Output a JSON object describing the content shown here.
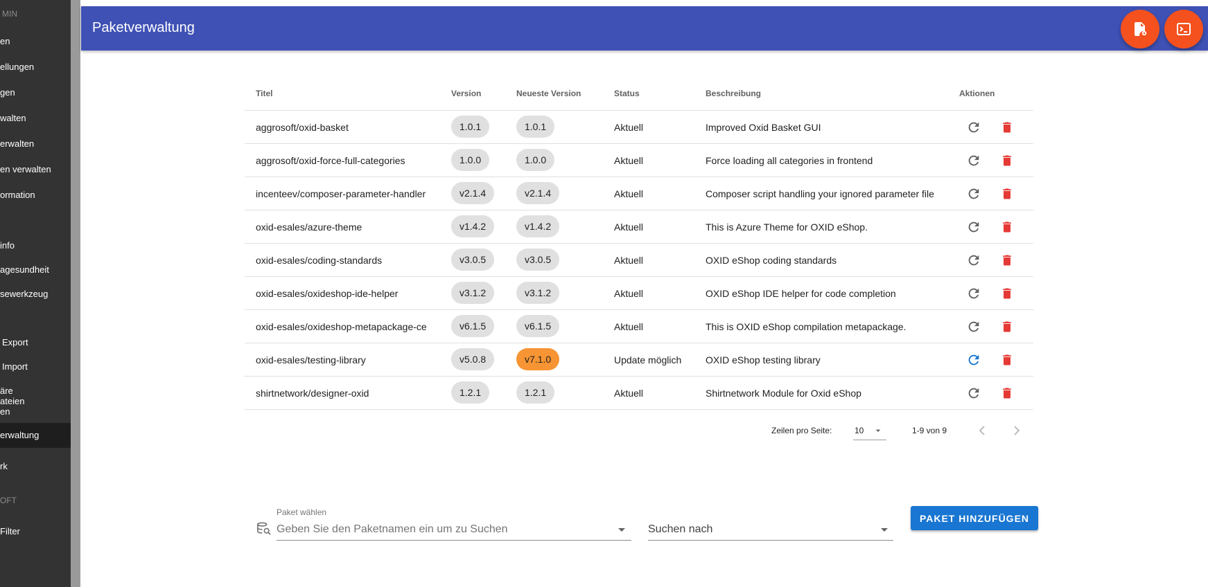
{
  "sidebar": {
    "items": [
      {
        "label": "MIN",
        "type": "section"
      },
      {
        "label": "en",
        "type": "item"
      },
      {
        "label": "ellungen",
        "type": "item"
      },
      {
        "label": "gen",
        "type": "item"
      },
      {
        "label": "walten",
        "type": "item"
      },
      {
        "label": "erwalten",
        "type": "item"
      },
      {
        "label": "en verwalten",
        "type": "item"
      },
      {
        "label": "ormation",
        "type": "item"
      },
      {
        "label": "info",
        "type": "item"
      },
      {
        "label": "agesundheit",
        "type": "item"
      },
      {
        "label": "sewerkzeug",
        "type": "item"
      },
      {
        "label": "Export",
        "type": "item"
      },
      {
        "label": "Import",
        "type": "item"
      },
      {
        "label": "äre\nateien\nen",
        "type": "item"
      },
      {
        "label": "erwaltung",
        "type": "item",
        "active": true
      },
      {
        "label": "rk",
        "type": "item"
      },
      {
        "label": "OFT",
        "type": "section"
      },
      {
        "label": "Filter",
        "type": "item"
      }
    ]
  },
  "appbar": {
    "title": "Paketverwaltung",
    "fab_icons": [
      "file-settings-icon",
      "console-icon"
    ]
  },
  "table": {
    "columns": [
      "Titel",
      "Version",
      "Neueste Version",
      "Status",
      "Beschreibung",
      "Aktionen"
    ],
    "rows": [
      {
        "title": "aggrosoft/oxid-basket",
        "version": "1.0.1",
        "latest": "1.0.1",
        "status": "Aktuell",
        "description": "Improved Oxid Basket GUI",
        "update": false
      },
      {
        "title": "aggrosoft/oxid-force-full-categories",
        "version": "1.0.0",
        "latest": "1.0.0",
        "status": "Aktuell",
        "description": "Force loading all categories in frontend",
        "update": false
      },
      {
        "title": "incenteev/composer-parameter-handler",
        "version": "v2.1.4",
        "latest": "v2.1.4",
        "status": "Aktuell",
        "description": "Composer script handling your ignored parameter file",
        "update": false
      },
      {
        "title": "oxid-esales/azure-theme",
        "version": "v1.4.2",
        "latest": "v1.4.2",
        "status": "Aktuell",
        "description": "This is Azure Theme for OXID eShop.",
        "update": false
      },
      {
        "title": "oxid-esales/coding-standards",
        "version": "v3.0.5",
        "latest": "v3.0.5",
        "status": "Aktuell",
        "description": "OXID eShop coding standards",
        "update": false
      },
      {
        "title": "oxid-esales/oxideshop-ide-helper",
        "version": "v3.1.2",
        "latest": "v3.1.2",
        "status": "Aktuell",
        "description": "OXID eShop IDE helper for code completion",
        "update": false
      },
      {
        "title": "oxid-esales/oxideshop-metapackage-ce",
        "version": "v6.1.5",
        "latest": "v6.1.5",
        "status": "Aktuell",
        "description": "This is OXID eShop compilation metapackage.",
        "update": false
      },
      {
        "title": "oxid-esales/testing-library",
        "version": "v5.0.8",
        "latest": "v7.1.0",
        "status": "Update möglich",
        "description": "OXID eShop testing library",
        "update": true
      },
      {
        "title": "shirtnetwork/designer-oxid",
        "version": "1.2.1",
        "latest": "1.2.1",
        "status": "Aktuell",
        "description": "Shirtnetwork Module for Oxid eShop",
        "update": false
      }
    ]
  },
  "pagination": {
    "rows_label": "Zeilen pro Seite:",
    "rows_value": "10",
    "range": "1-9 von 9"
  },
  "form": {
    "package_label": "Paket wählen",
    "package_placeholder": "Geben Sie den Paketnamen ein um zu Suchen",
    "search_placeholder": "Suchen nach",
    "add_button": "PAKET HINZUFÜGEN"
  },
  "colors": {
    "appbar": "#3f51b5",
    "fab": "#f4511e",
    "update_chip": "#f79433",
    "delete": "#e53935",
    "update_icon": "#1976d2",
    "primary_button": "#1976d2"
  }
}
